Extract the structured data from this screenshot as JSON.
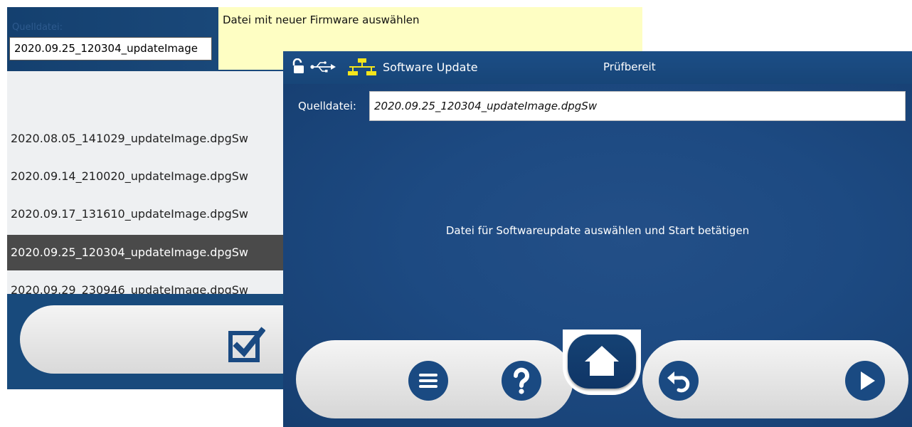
{
  "back_window": {
    "source_label": "Quelldatei:",
    "source_value": "2020.09.25_120304_updateImage",
    "tooltip": "Datei mit neuer Firmware auswählen",
    "files": [
      "2020.08.05_141029_updateImage.dpgSw",
      "2020.09.14_210020_updateImage.dpgSw",
      "2020.09.17_131610_updateImage.dpgSw",
      "2020.09.25_120304_updateImage.dpgSw",
      "2020.09.29_230946_updateImage.dpgSw"
    ],
    "selected_file": "2020.09.25_120304_updateImage.dpgSw",
    "confirm_icon": "checkbox-checked-icon"
  },
  "front_window": {
    "title": "Software Update",
    "status": "Prüfbereit",
    "source_label": "Quelldatei:",
    "source_value": "2020.09.25_120304_updateImage.dpgSw",
    "message": "Datei für Softwareupdate auswählen und Start betätigen",
    "status_icons": [
      "unlock-icon",
      "usb-icon",
      "network-icon"
    ],
    "toolbar": [
      "menu-icon",
      "help-icon",
      "home-icon",
      "back-icon",
      "play-icon"
    ]
  },
  "colors": {
    "panel_blue": "#1d4a82",
    "button_blue": "#1a4a82",
    "tooltip_yellow": "#fefec3",
    "selected_row": "#4a4a4a",
    "network_yellow": "#f5e51c"
  }
}
